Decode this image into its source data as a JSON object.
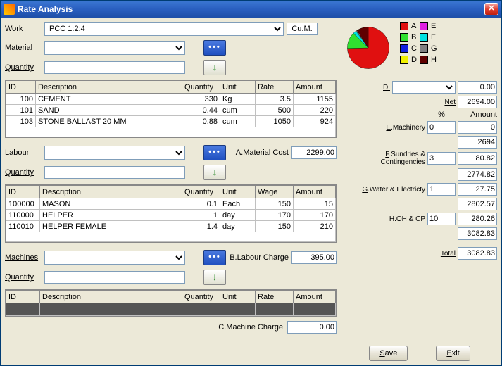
{
  "window": {
    "title": "Rate Analysis"
  },
  "work": {
    "label": "Work",
    "value": "PCC 1:2:4",
    "unit": "Cu.M."
  },
  "material": {
    "label": "Material",
    "qty_label": "Quantity"
  },
  "labour": {
    "label": "Labour",
    "qty_label": "Quantity"
  },
  "machines": {
    "label": "Machines",
    "qty_label": "Quantity"
  },
  "headers": {
    "mat": [
      "ID",
      "Description",
      "Quantity",
      "Unit",
      "Rate",
      "Amount"
    ],
    "lab": [
      "ID",
      "Description",
      "Quantity",
      "Unit",
      "Wage",
      "Amount"
    ],
    "mac": [
      "ID",
      "Description",
      "Quantity",
      "Unit",
      "Rate",
      "Amount"
    ]
  },
  "material_rows": [
    {
      "id": "100",
      "desc": "CEMENT",
      "qty": "330",
      "unit": "Kg",
      "rate": "3.5",
      "amount": "1155"
    },
    {
      "id": "101",
      "desc": "SAND",
      "qty": "0.44",
      "unit": "cum",
      "rate": "500",
      "amount": "220"
    },
    {
      "id": "103",
      "desc": "STONE BALLAST 20 MM",
      "qty": "0.88",
      "unit": "cum",
      "rate": "1050",
      "amount": "924"
    }
  ],
  "labour_rows": [
    {
      "id": "100000",
      "desc": "MASON",
      "qty": "0.1",
      "unit": "Each",
      "wage": "150",
      "amount": "15"
    },
    {
      "id": "110000",
      "desc": "HELPER",
      "qty": "1",
      "unit": "day",
      "wage": "170",
      "amount": "170"
    },
    {
      "id": "110010",
      "desc": "HELPER FEMALE",
      "qty": "1.4",
      "unit": "day",
      "wage": "150",
      "amount": "210"
    }
  ],
  "machine_rows": [],
  "costs": {
    "material_label": "A.Material Cost",
    "material": "2299.00",
    "labour_label": "B.Labour Charge",
    "labour": "395.00",
    "machine_label": "C.Machine Charge",
    "machine": "0.00"
  },
  "legend": [
    {
      "k": "A",
      "c": "#e01010"
    },
    {
      "k": "B",
      "c": "#30e030"
    },
    {
      "k": "C",
      "c": "#1020e0"
    },
    {
      "k": "D",
      "c": "#f0f000"
    },
    {
      "k": "E",
      "c": "#e020e0"
    },
    {
      "k": "F",
      "c": "#00e0e0"
    },
    {
      "k": "G",
      "c": "#808080"
    },
    {
      "k": "H",
      "c": "#600000"
    }
  ],
  "calc": {
    "d_label": "D.",
    "d_value": "0.00",
    "net_label": "Net",
    "net": "2694.00",
    "pct_label": "%",
    "amount_label": "Amount",
    "e_label": "E.Machinery",
    "e_pct": "0",
    "e_amt": "0",
    "sub1": "2694",
    "f_label": "F.Sundries & Contingencies",
    "f_pct": "3",
    "f_amt": "80.82",
    "sub2": "2774.82",
    "g_label": "G.Water & Electricty",
    "g_pct": "1",
    "g_amt": "27.75",
    "sub3": "2802.57",
    "h_label": "H.OH & CP",
    "h_pct": "10",
    "h_amt": "280.26",
    "sub4": "3082.83",
    "total_label": "Total",
    "total": "3082.83"
  },
  "buttons": {
    "save": "Save",
    "exit": "Exit"
  },
  "chart_data": {
    "type": "pie",
    "title": "",
    "series": [
      {
        "name": "A",
        "value": 2299,
        "color": "#e01010"
      },
      {
        "name": "B",
        "value": 395,
        "color": "#30e030"
      },
      {
        "name": "C",
        "value": 0,
        "color": "#1020e0"
      },
      {
        "name": "D",
        "value": 0,
        "color": "#f0f000"
      },
      {
        "name": "E",
        "value": 0,
        "color": "#e020e0"
      },
      {
        "name": "F",
        "value": 80.82,
        "color": "#00e0e0"
      },
      {
        "name": "G",
        "value": 27.75,
        "color": "#808080"
      },
      {
        "name": "H",
        "value": 280.26,
        "color": "#600000"
      }
    ]
  }
}
